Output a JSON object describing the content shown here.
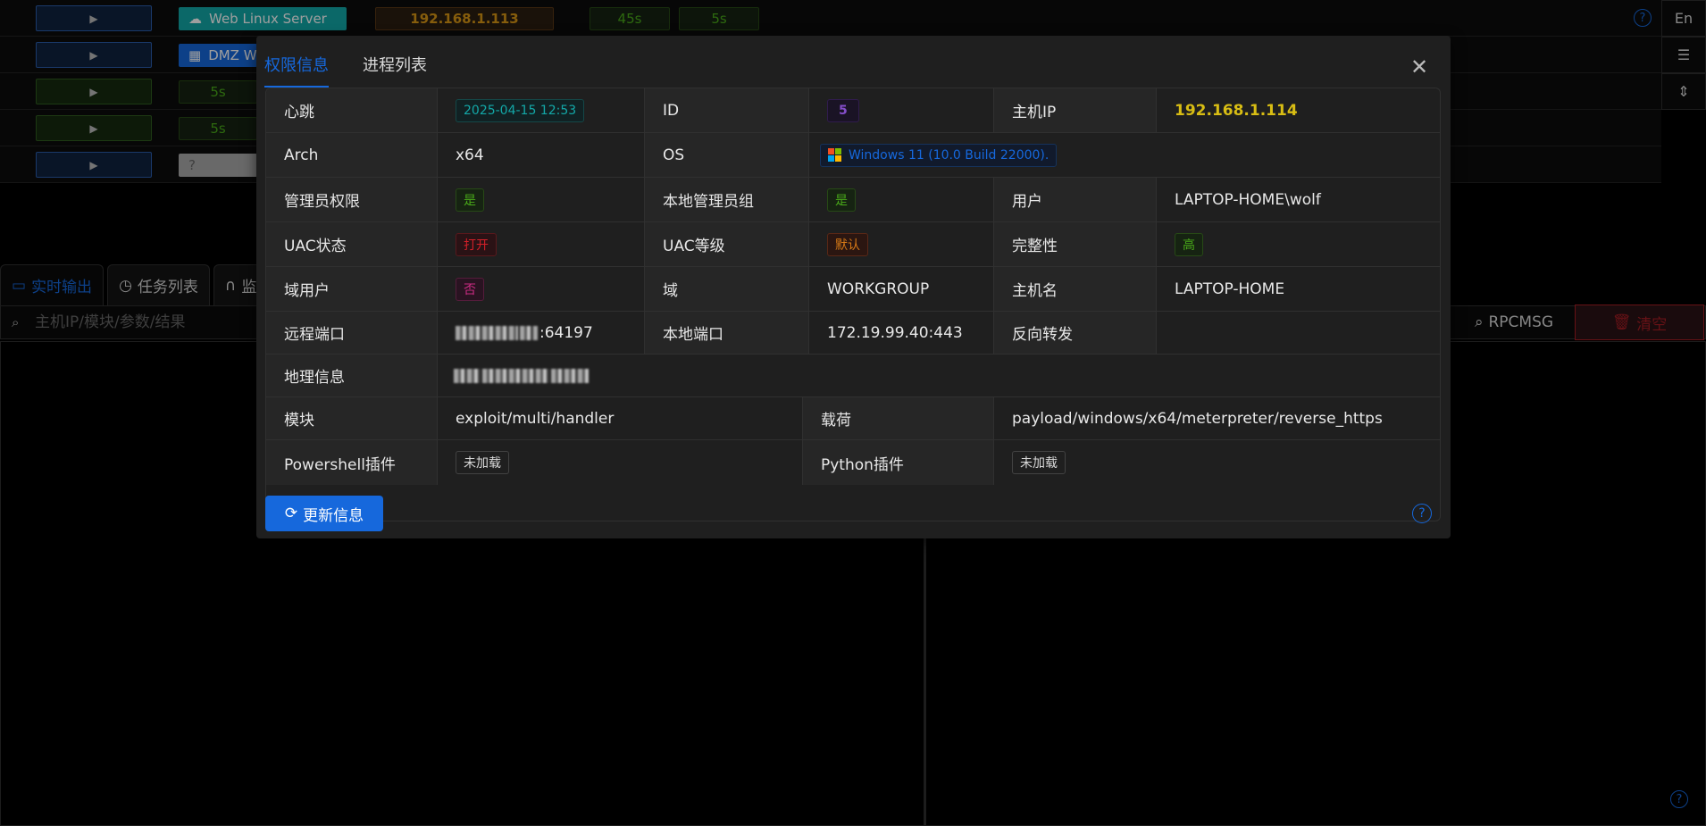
{
  "background": {
    "rows": [
      {
        "tag": "Web Linux Server",
        "ip": "192.168.1.113",
        "t1": "45s",
        "t2": "5s"
      },
      {
        "tag": "DMZ Wi"
      },
      {
        "tag": "5s"
      },
      {
        "tag": "5s"
      },
      {
        "tag": "?"
      }
    ],
    "toolbar": {
      "lang": "En"
    },
    "bottom_tabs": [
      {
        "label": "实时输出"
      },
      {
        "label": "任务列表"
      },
      {
        "label": "监"
      }
    ],
    "search": {
      "placeholder": "主机IP/模块/参数/结果"
    },
    "rpc_label": "RPCMSG",
    "clear_label": "清空"
  },
  "modal": {
    "tabs": [
      {
        "label": "权限信息",
        "active": true
      },
      {
        "label": "进程列表",
        "active": false
      }
    ],
    "rows": {
      "r0": {
        "l1": "心跳",
        "v1": "2025-04-15 12:53",
        "l2": "ID",
        "v2": "5",
        "l3": "主机IP",
        "v3": "192.168.1.114"
      },
      "r1": {
        "l1": "Arch",
        "v1": "x64",
        "l2": "OS",
        "v2": "Windows 11 (10.0 Build 22000)."
      },
      "r2": {
        "l1": "管理员权限",
        "v1": "是",
        "l2": "本地管理员组",
        "v2": "是",
        "l3": "用户",
        "v3": "LAPTOP-HOME\\wolf"
      },
      "r3": {
        "l1": "UAC状态",
        "v1": "打开",
        "l2": "UAC等级",
        "v2": "默认",
        "l3": "完整性",
        "v3": "高"
      },
      "r4": {
        "l1": "域用户",
        "v1": "否",
        "l2": "域",
        "v2": "WORKGROUP",
        "l3": "主机名",
        "v3": "LAPTOP-HOME"
      },
      "r5": {
        "l1": "远程端口",
        "v1": ":64197",
        "l2": "本地端口",
        "v2": "172.19.99.40:443",
        "l3": "反向转发",
        "v3": ""
      },
      "r6": {
        "l1": "地理信息"
      },
      "r7": {
        "l1": "模块",
        "v1": "exploit/multi/handler",
        "l2": "载荷",
        "v2": "payload/windows/x64/meterpreter/reverse_https"
      },
      "r8": {
        "l1": "Powershell插件",
        "v1": "未加载",
        "l2": "Python插件",
        "v2": "未加载"
      }
    },
    "update_label": "更新信息"
  },
  "colors": {
    "accent": "#1668dc",
    "gold": "#d8bd14"
  }
}
